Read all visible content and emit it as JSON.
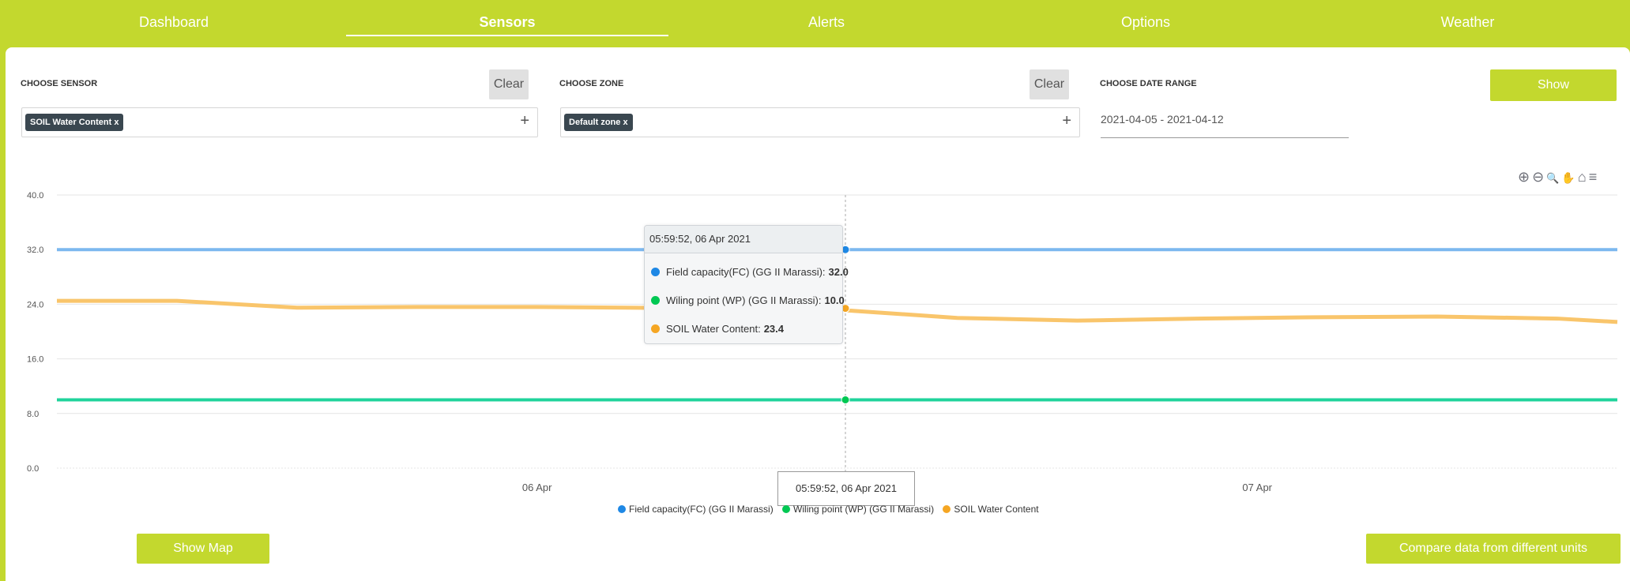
{
  "nav": {
    "items": [
      "Dashboard",
      "Sensors",
      "Alerts",
      "Options",
      "Weather"
    ],
    "active": "Sensors"
  },
  "filters": {
    "sensor_label": "CHOOSE SENSOR",
    "sensor_clear": "Clear",
    "sensor_chip": "SOIL Water Content x",
    "zone_label": "CHOOSE ZONE",
    "zone_clear": "Clear",
    "zone_chip": "Default zone x",
    "date_label": "CHOOSE DATE RANGE",
    "date_value": "2021-04-05 - 2021-04-12",
    "show_button": "Show",
    "plus": "+"
  },
  "toolbar": {
    "icons": [
      "zoom-in-icon",
      "zoom-out-icon",
      "zoom-select-icon",
      "pan-icon",
      "home-icon",
      "menu-icon"
    ],
    "glyphs": [
      "⊕",
      "⊖",
      "🔍",
      "✋",
      "⌂",
      "≡"
    ]
  },
  "chart_data": {
    "type": "line",
    "ylim": [
      0,
      40
    ],
    "yticks": [
      "40.0",
      "32.0",
      "24.0",
      "16.0",
      "8.0",
      "0.0"
    ],
    "xticks": [
      "06 Apr",
      "07 Apr"
    ],
    "x_range": [
      "2021-04-05 08:00",
      "2021-04-07 12:00"
    ],
    "grid": true,
    "legend_position": "bottom",
    "series": [
      {
        "name": "Field capacity(FC) (GG II Marassi)",
        "color": "#7cb8ef",
        "x": [
          "2021-04-05 08:00",
          "2021-04-07 12:00"
        ],
        "values": [
          32.0,
          32.0
        ]
      },
      {
        "name": "Wiling point (WP) (GG II Marassi)",
        "color": "#1fd39b",
        "x": [
          "2021-04-05 08:00",
          "2021-04-07 12:00"
        ],
        "values": [
          10.0,
          10.0
        ]
      },
      {
        "name": "SOIL Water Content",
        "color": "#f9c56b",
        "x": [
          "2021-04-05 08:00",
          "2021-04-05 12:00",
          "2021-04-05 16:00",
          "2021-04-05 20:00",
          "2021-04-06 00:00",
          "2021-04-06 05:59",
          "2021-04-06 10:00",
          "2021-04-06 14:00",
          "2021-04-06 18:00",
          "2021-04-06 22:00",
          "2021-04-07 02:00",
          "2021-04-07 06:00",
          "2021-04-07 10:00",
          "2021-04-07 12:00"
        ],
        "values": [
          24.5,
          24.5,
          23.5,
          23.6,
          23.6,
          23.4,
          23.2,
          22.0,
          21.6,
          21.9,
          22.1,
          22.2,
          21.9,
          21.4
        ]
      }
    ]
  },
  "tooltip": {
    "header": "05:59:52, 06 Apr 2021",
    "rows": [
      {
        "label": "Field capacity(FC) (GG II Marassi):",
        "value": "32.0",
        "color": "#1e88e5"
      },
      {
        "label": "Wiling point (WP) (GG II Marassi):",
        "value": "10.0",
        "color": "#00c853"
      },
      {
        "label": "SOIL Water Content:",
        "value": "23.4",
        "color": "#f5a623"
      }
    ],
    "x_label": "05:59:52, 06 Apr 2021"
  },
  "legend": {
    "items": [
      {
        "label": "Field capacity(FC) (GG II Marassi)",
        "color": "#1e88e5"
      },
      {
        "label": "Wiling point (WP) (GG II Marassi)",
        "color": "#00c853"
      },
      {
        "label": "SOIL Water Content",
        "color": "#f5a623"
      }
    ]
  },
  "buttons": {
    "show_map": "Show Map",
    "compare": "Compare data from different units"
  }
}
